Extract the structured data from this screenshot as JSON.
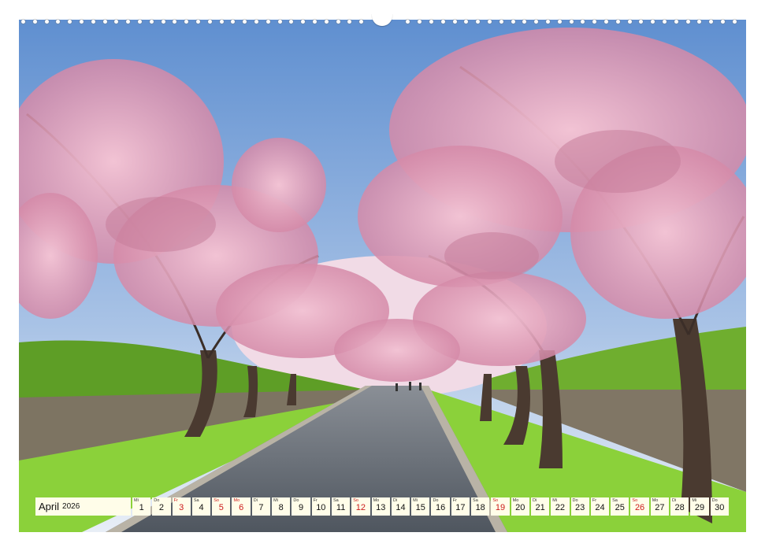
{
  "calendar": {
    "month": "April",
    "year": "2026",
    "days": [
      {
        "wd": "Mi",
        "d": "1",
        "red": false
      },
      {
        "wd": "Do",
        "d": "2",
        "red": false
      },
      {
        "wd": "Fr",
        "d": "3",
        "red": true
      },
      {
        "wd": "Sa",
        "d": "4",
        "red": false
      },
      {
        "wd": "So",
        "d": "5",
        "red": true
      },
      {
        "wd": "Mo",
        "d": "6",
        "red": true
      },
      {
        "wd": "Di",
        "d": "7",
        "red": false
      },
      {
        "wd": "Mi",
        "d": "8",
        "red": false
      },
      {
        "wd": "Do",
        "d": "9",
        "red": false
      },
      {
        "wd": "Fr",
        "d": "10",
        "red": false
      },
      {
        "wd": "Sa",
        "d": "11",
        "red": false
      },
      {
        "wd": "So",
        "d": "12",
        "red": true
      },
      {
        "wd": "Mo",
        "d": "13",
        "red": false
      },
      {
        "wd": "Di",
        "d": "14",
        "red": false
      },
      {
        "wd": "Mi",
        "d": "15",
        "red": false
      },
      {
        "wd": "Do",
        "d": "16",
        "red": false
      },
      {
        "wd": "Fr",
        "d": "17",
        "red": false
      },
      {
        "wd": "Sa",
        "d": "18",
        "red": false
      },
      {
        "wd": "So",
        "d": "19",
        "red": true
      },
      {
        "wd": "Mo",
        "d": "20",
        "red": false
      },
      {
        "wd": "Di",
        "d": "21",
        "red": false
      },
      {
        "wd": "Mi",
        "d": "22",
        "red": false
      },
      {
        "wd": "Do",
        "d": "23",
        "red": false
      },
      {
        "wd": "Fr",
        "d": "24",
        "red": false
      },
      {
        "wd": "Sa",
        "d": "25",
        "red": false
      },
      {
        "wd": "So",
        "d": "26",
        "red": true
      },
      {
        "wd": "Mo",
        "d": "27",
        "red": false
      },
      {
        "wd": "Di",
        "d": "28",
        "red": false
      },
      {
        "wd": "Mi",
        "d": "29",
        "red": false
      },
      {
        "wd": "Do",
        "d": "30",
        "red": false
      }
    ],
    "colors": {
      "cell_bg": "#fffde9",
      "holiday": "#cc1b1b",
      "text": "#111111"
    }
  },
  "photo": {
    "colors": {
      "sky": "#6f9fd6",
      "blossom": "#e8a9c0",
      "blossom_dark": "#c77d9a",
      "hedge": "#6fae2f",
      "grass": "#8bd13a",
      "road": "#5f6670",
      "wall": "#7d7462",
      "trunk": "#4a3a30"
    }
  }
}
